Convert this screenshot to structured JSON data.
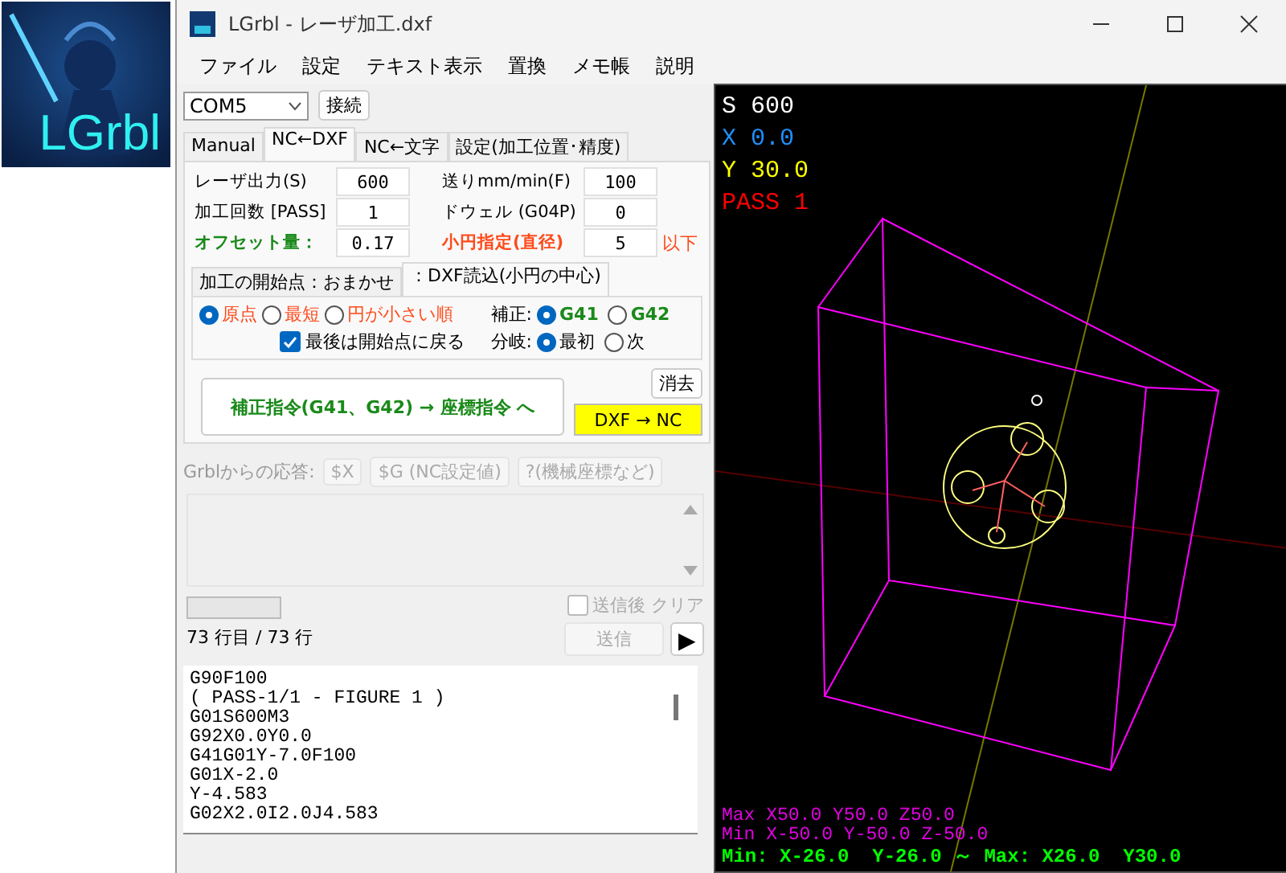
{
  "logo": {
    "text": "LGrbl"
  },
  "window": {
    "title": "LGrbl - レーザ加工.dxf"
  },
  "menu": [
    "ファイル",
    "設定",
    "テキスト表示",
    "置換",
    "メモ帳",
    "説明"
  ],
  "port": {
    "value": "COM5"
  },
  "connect_button": "接続",
  "tabs": [
    {
      "label": "Manual",
      "selected": false
    },
    {
      "label": "NC←DXF",
      "selected": true
    },
    {
      "label": "NC←文字",
      "selected": false
    },
    {
      "label": "設定(加工位置･精度)",
      "selected": false
    }
  ],
  "params": [
    {
      "label": "レーザ出力(S)",
      "value": "600",
      "color": "#000000"
    },
    {
      "label": "送りmm/min(F)",
      "value": "100",
      "color": "#000000"
    },
    {
      "label": "加工回数 [PASS]",
      "value": "1",
      "color": "#000000"
    },
    {
      "label": "ドウェル (G04P)",
      "value": "0",
      "color": "#000000"
    },
    {
      "label": "オフセット量：",
      "value": "0.17",
      "color": "#1a8a1a"
    },
    {
      "label": "小円指定(直径)",
      "value": "5",
      "color": "#ff4a1a",
      "suffix": "以下"
    }
  ],
  "subtabs": [
    {
      "label": "加工の開始点：おまかせ",
      "selected": false
    },
    {
      "label": "：DXF読込(小円の中心)",
      "selected": true
    }
  ],
  "start_points": [
    {
      "label": "原点",
      "selected": true
    },
    {
      "label": "最短",
      "selected": false
    },
    {
      "label": "円が小さい順",
      "selected": false
    }
  ],
  "return_checkbox": {
    "label": "最後は開始点に戻る",
    "checked": true
  },
  "compensation": {
    "label": "補正:",
    "options": [
      {
        "label": "G41",
        "selected": true
      },
      {
        "label": "G42",
        "selected": false
      }
    ]
  },
  "branch": {
    "label": "分岐:",
    "options": [
      {
        "label": "最初",
        "selected": true
      },
      {
        "label": "次",
        "selected": false
      }
    ]
  },
  "convert_button": "補正指令(G41、G42) → 座標指令 へ",
  "clear_button": "消去",
  "dxf_nc_button": "DXF → NC",
  "response": {
    "label": "Grblからの応答:",
    "buttons": [
      "$X",
      "$G (NC設定値)",
      "?(機械座標など)"
    ],
    "disabled": true
  },
  "progress": {
    "level": 0
  },
  "line_status": "73 行目 / 73 行",
  "clear_after_send": {
    "label": "送信後 クリア",
    "checked": false,
    "disabled": true
  },
  "send_button": {
    "label": "送信",
    "disabled": true
  },
  "play_button": "▶",
  "gcode": [
    "G90F100",
    "( PASS-1/1 - FIGURE 1 )",
    "G01S600M3",
    "G92X0.0Y0.0",
    "G41G01Y-7.0F100",
    "G01X-2.0",
    "Y-4.583",
    "G02X2.0I2.0J4.583"
  ],
  "viewer": {
    "readouts": [
      {
        "text": "S 600",
        "color": "#ffffff"
      },
      {
        "text": "X 0.0",
        "color": "#1e90ff"
      },
      {
        "text": "Y 30.0",
        "color": "#ffff00"
      },
      {
        "text": "PASS 1",
        "color": "#ff0000"
      }
    ],
    "limits": [
      "Max X50.0 Y50.0 Z50.0",
      "Min X-50.0 Y-50.0 Z-50.0"
    ],
    "range": "Min: X-26.0  Y-26.0 ～ Max: X26.0  Y30.0"
  }
}
